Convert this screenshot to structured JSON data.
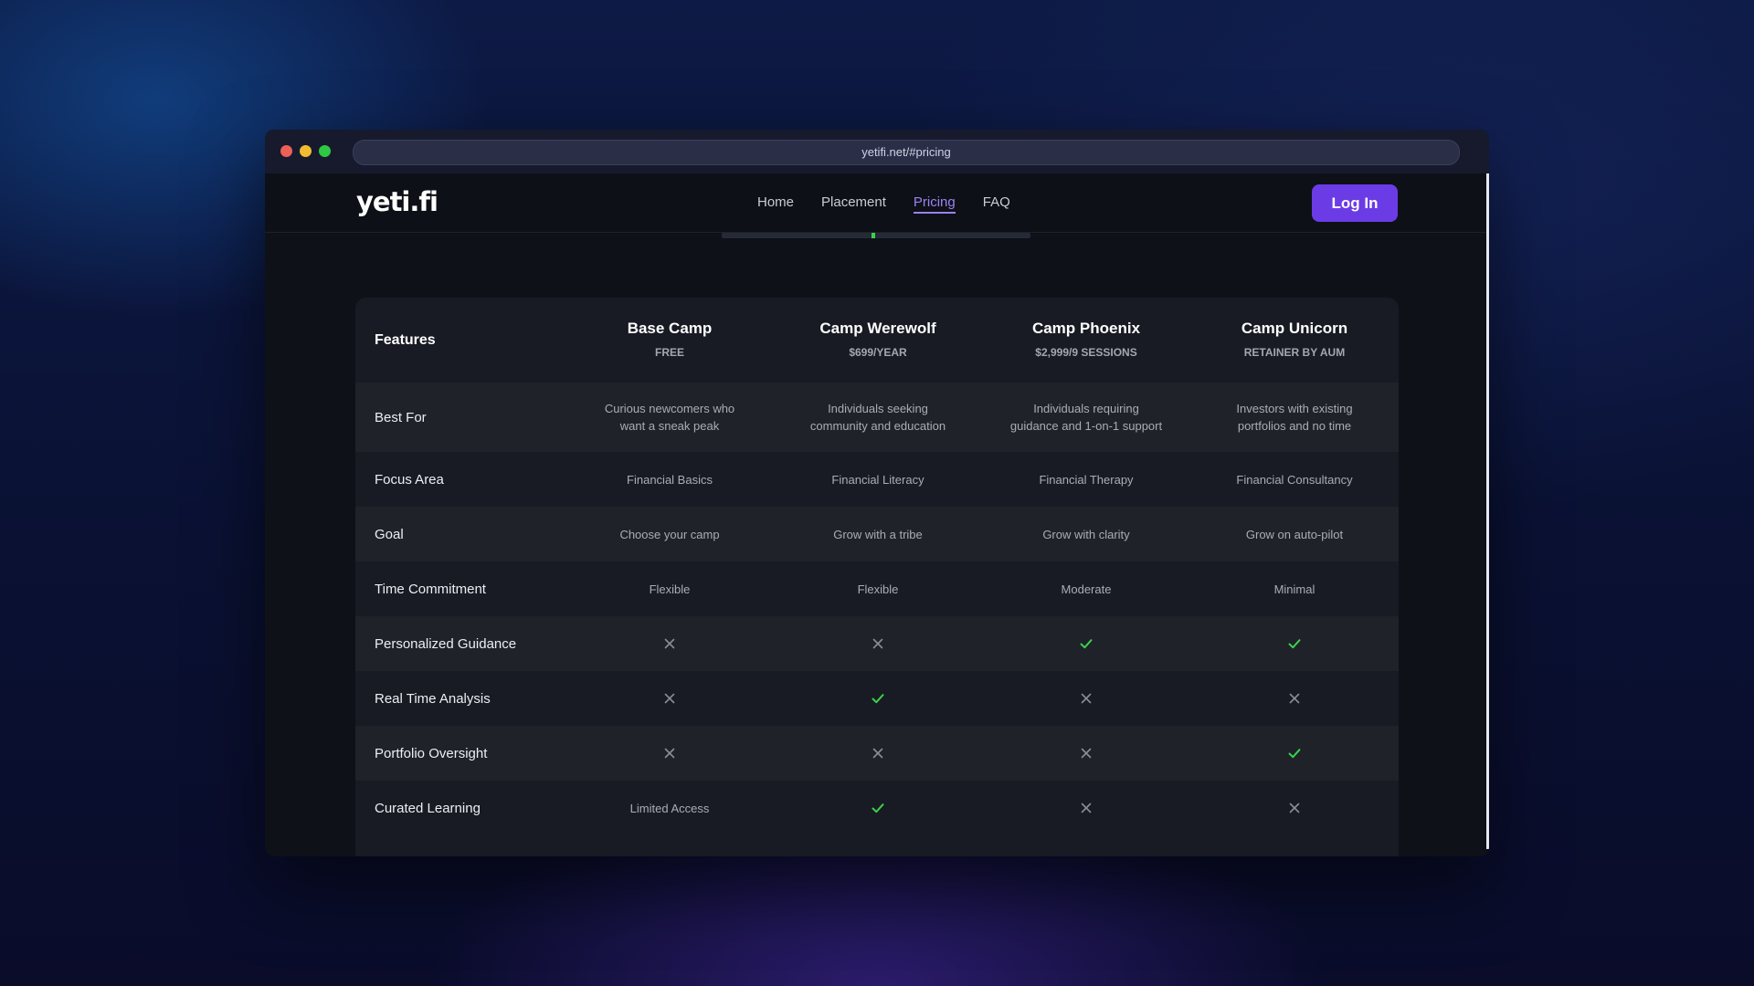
{
  "browser": {
    "url": "yetifi.net/#pricing"
  },
  "nav": {
    "logo": "yeti.fi",
    "items": [
      {
        "label": "Home",
        "active": false
      },
      {
        "label": "Placement",
        "active": false
      },
      {
        "label": "Pricing",
        "active": true
      },
      {
        "label": "FAQ",
        "active": false
      }
    ],
    "login_label": "Log In"
  },
  "scroll_progress": 0.49,
  "colors": {
    "accent": "#6b3be6",
    "active_link": "#9b82f5",
    "check": "#3bd14a",
    "cross": "#8a8e99"
  },
  "pricing": {
    "features_label": "Features",
    "plans": [
      {
        "name": "Base Camp",
        "price": "FREE"
      },
      {
        "name": "Camp Werewolf",
        "price": "$699/YEAR"
      },
      {
        "name": "Camp Phoenix",
        "price": "$2,999/9 SESSIONS"
      },
      {
        "name": "Camp Unicorn",
        "price": "RETAINER BY AUM"
      }
    ],
    "rows": [
      {
        "feature": "Best For",
        "values": [
          "Curious newcomers who want a sneak peak",
          "Individuals seeking community and education",
          "Individuals requiring guidance and 1-on-1 support",
          "Investors with existing portfolios and no time"
        ]
      },
      {
        "feature": "Focus Area",
        "values": [
          "Financial Basics",
          "Financial Literacy",
          "Financial Therapy",
          "Financial Consultancy"
        ]
      },
      {
        "feature": "Goal",
        "values": [
          "Choose your camp",
          "Grow with a tribe",
          "Grow with clarity",
          "Grow on auto-pilot"
        ]
      },
      {
        "feature": "Time Commitment",
        "values": [
          "Flexible",
          "Flexible",
          "Moderate",
          "Minimal"
        ]
      },
      {
        "feature": "Personalized Guidance",
        "values": [
          "cross-icon",
          "cross-icon",
          "check-icon",
          "check-icon"
        ]
      },
      {
        "feature": "Real Time Analysis",
        "values": [
          "cross-icon",
          "check-icon",
          "cross-icon",
          "cross-icon"
        ]
      },
      {
        "feature": "Portfolio Oversight",
        "values": [
          "cross-icon",
          "cross-icon",
          "cross-icon",
          "check-icon"
        ]
      },
      {
        "feature": "Curated Learning",
        "values": [
          "Limited Access",
          "check-icon",
          "cross-icon",
          "cross-icon"
        ]
      }
    ]
  }
}
